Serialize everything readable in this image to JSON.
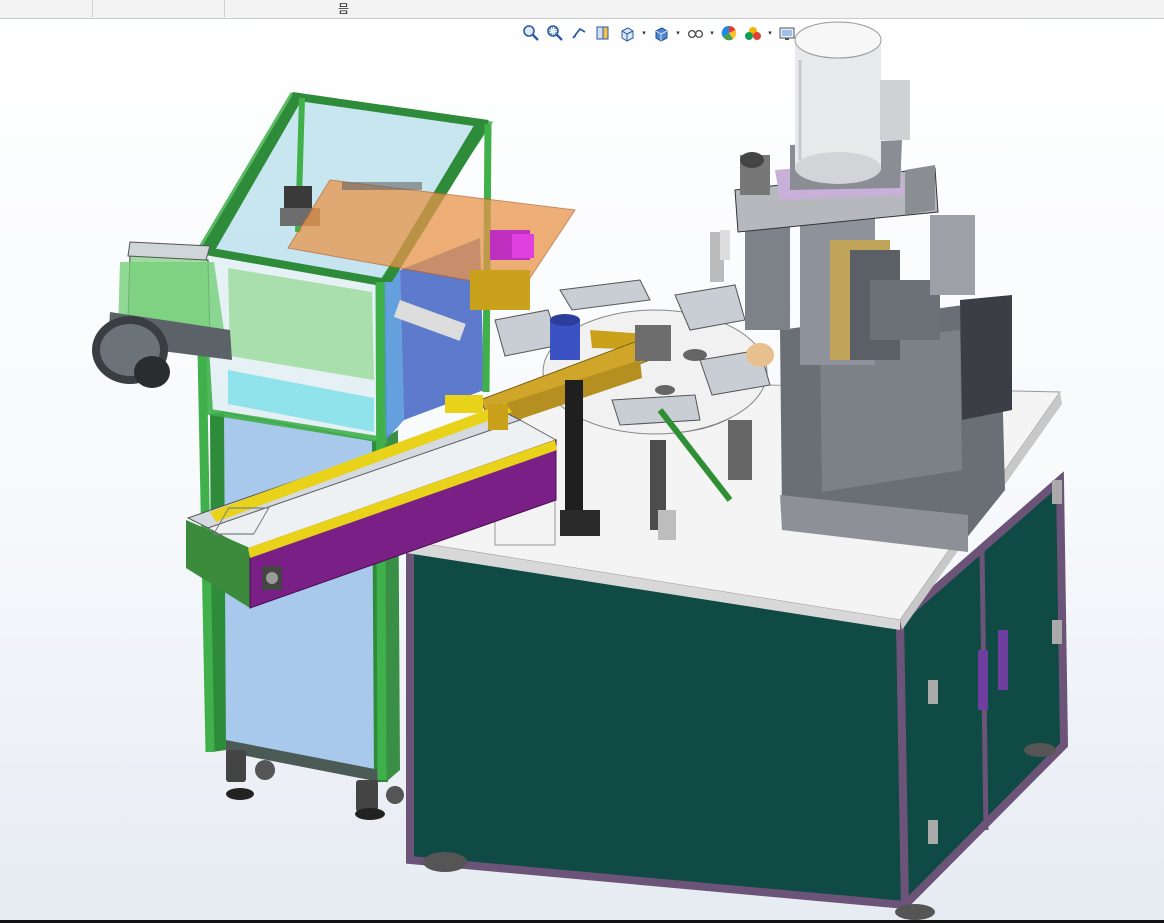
{
  "window": {
    "top_glyph": "믐"
  },
  "toolbar": {
    "buttons": [
      {
        "name": "zoom-to-fit-icon"
      },
      {
        "name": "zoom-to-area-icon"
      },
      {
        "name": "previous-view-icon"
      },
      {
        "name": "section-view-icon"
      },
      {
        "name": "view-orientation-icon",
        "dropdown": true
      },
      {
        "name": "display-style-icon",
        "dropdown": true
      },
      {
        "name": "hide-show-items-icon",
        "dropdown": true
      },
      {
        "name": "edit-appearance-icon"
      },
      {
        "name": "apply-scene-icon",
        "dropdown": true
      },
      {
        "name": "view-settings-icon",
        "dropdown": true
      }
    ]
  },
  "colors": {
    "frame_green": "#3fb04a",
    "cabinet_teal": "#0f4a45",
    "cabinet_frame": "#6c5478",
    "table_top": "#f4f4f4",
    "purple_conveyor": "#7a1f86",
    "yellow_rail": "#e8d21a",
    "glass_blue": "#bfe2ee",
    "orange_plate": "#e9954a",
    "light_blue_panel": "#a9c9ec",
    "machine_gray": "#8d8d92"
  }
}
